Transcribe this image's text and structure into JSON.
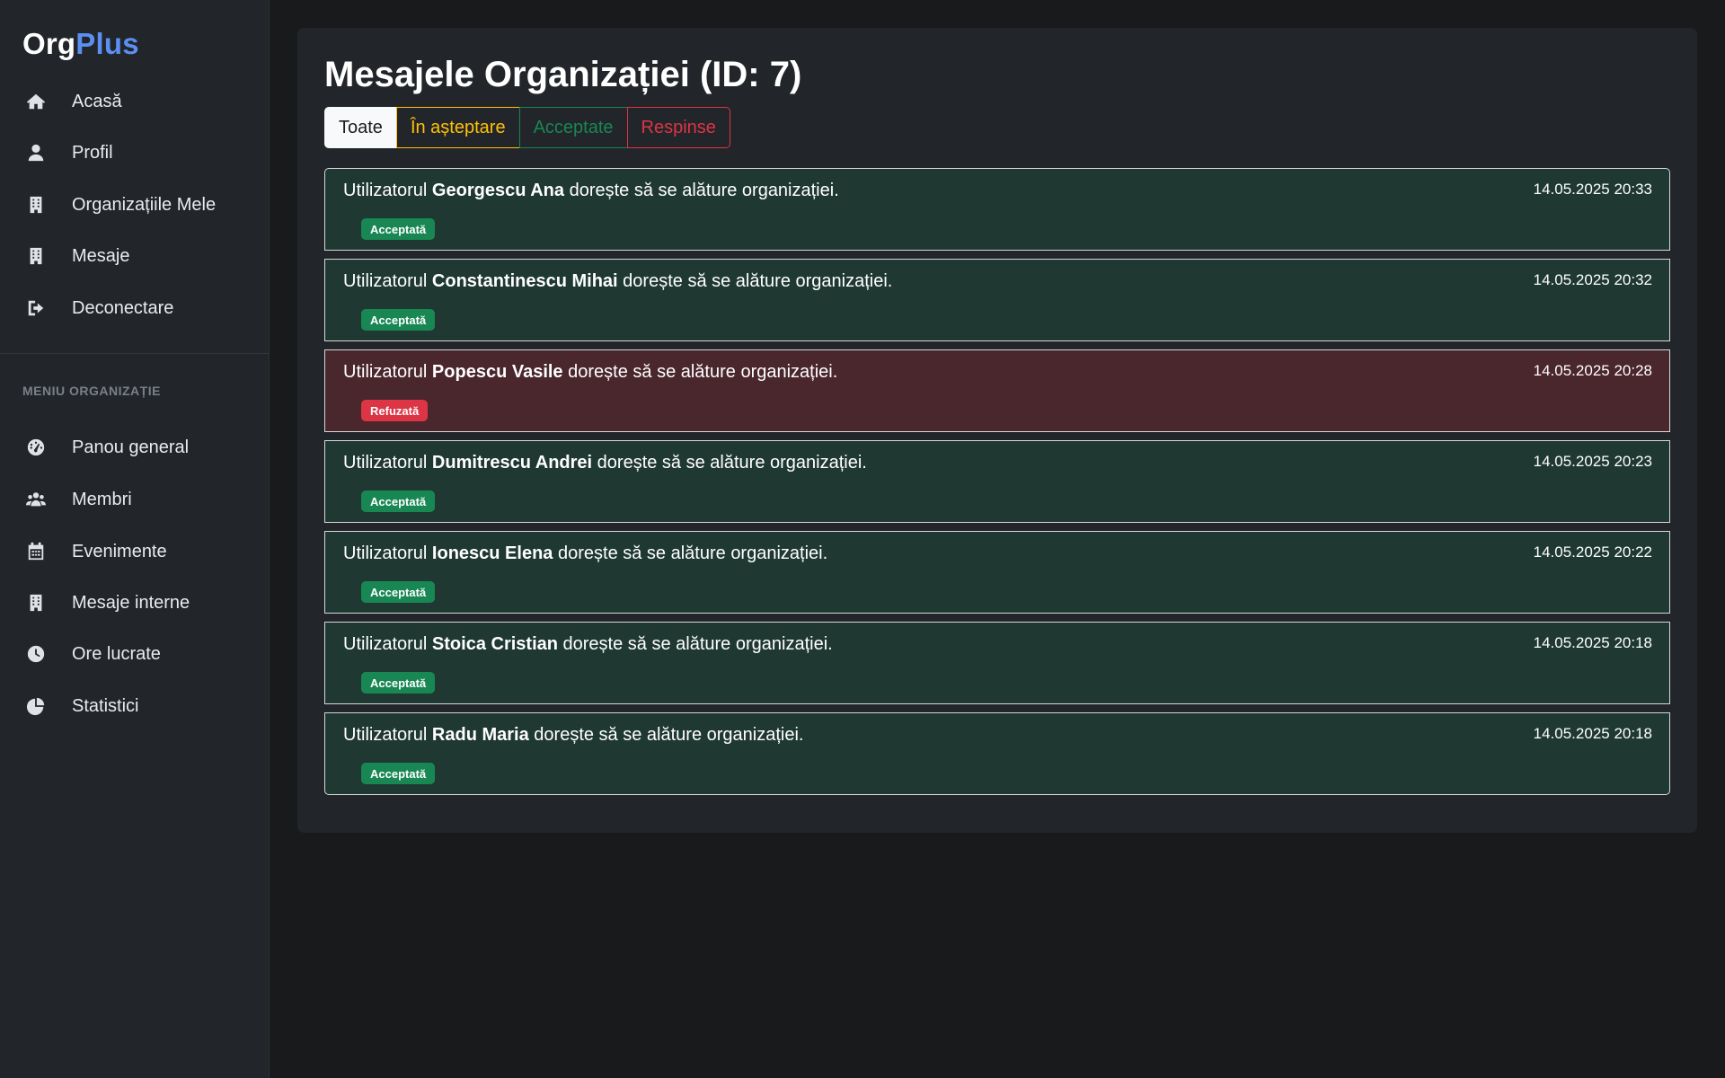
{
  "brand": {
    "part1": "Org",
    "part2": "Plus"
  },
  "nav": [
    {
      "label": "Acasă",
      "icon": "home-icon"
    },
    {
      "label": "Profil",
      "icon": "user-icon"
    },
    {
      "label": "Organizațiile Mele",
      "icon": "building-icon"
    },
    {
      "label": "Mesaje",
      "icon": "building-icon"
    },
    {
      "label": "Deconectare",
      "icon": "logout-icon"
    }
  ],
  "org_menu": {
    "title": "MENIU ORGANIZAȚIE",
    "items": [
      {
        "label": "Panou general",
        "icon": "dashboard-icon"
      },
      {
        "label": "Membri",
        "icon": "users-icon"
      },
      {
        "label": "Evenimente",
        "icon": "calendar-icon"
      },
      {
        "label": "Mesaje interne",
        "icon": "building-icon"
      },
      {
        "label": "Ore lucrate",
        "icon": "clock-icon"
      },
      {
        "label": "Statistici",
        "icon": "pie-chart-icon"
      }
    ]
  },
  "page": {
    "title": "Mesajele Organizației (ID: 7)",
    "filters": {
      "all": "Toate",
      "pending": "În așteptare",
      "accepted": "Acceptate",
      "rejected": "Respinse"
    }
  },
  "colors": {
    "brand_accent": "#5b8ff2",
    "accepted": "#198754",
    "refused": "#dc3545",
    "pending": "#ffc107"
  },
  "messages": [
    {
      "prefix": "Utilizatorul ",
      "name": "Georgescu Ana",
      "suffix": " dorește să se alăture organizației.",
      "time": "14.05.2025 20:33",
      "status": "Acceptată",
      "state": "accepted"
    },
    {
      "prefix": "Utilizatorul ",
      "name": "Constantinescu Mihai",
      "suffix": " dorește să se alăture organizației.",
      "time": "14.05.2025 20:32",
      "status": "Acceptată",
      "state": "accepted"
    },
    {
      "prefix": "Utilizatorul ",
      "name": "Popescu Vasile",
      "suffix": " dorește să se alăture organizației.",
      "time": "14.05.2025 20:28",
      "status": "Refuzată",
      "state": "refused"
    },
    {
      "prefix": "Utilizatorul ",
      "name": "Dumitrescu Andrei",
      "suffix": " dorește să se alăture organizației.",
      "time": "14.05.2025 20:23",
      "status": "Acceptată",
      "state": "accepted"
    },
    {
      "prefix": "Utilizatorul ",
      "name": "Ionescu Elena",
      "suffix": " dorește să se alăture organizației.",
      "time": "14.05.2025 20:22",
      "status": "Acceptată",
      "state": "accepted"
    },
    {
      "prefix": "Utilizatorul ",
      "name": "Stoica Cristian",
      "suffix": " dorește să se alăture organizației.",
      "time": "14.05.2025 20:18",
      "status": "Acceptată",
      "state": "accepted"
    },
    {
      "prefix": "Utilizatorul ",
      "name": "Radu Maria",
      "suffix": " dorește să se alăture organizației.",
      "time": "14.05.2025 20:18",
      "status": "Acceptată",
      "state": "accepted"
    }
  ]
}
